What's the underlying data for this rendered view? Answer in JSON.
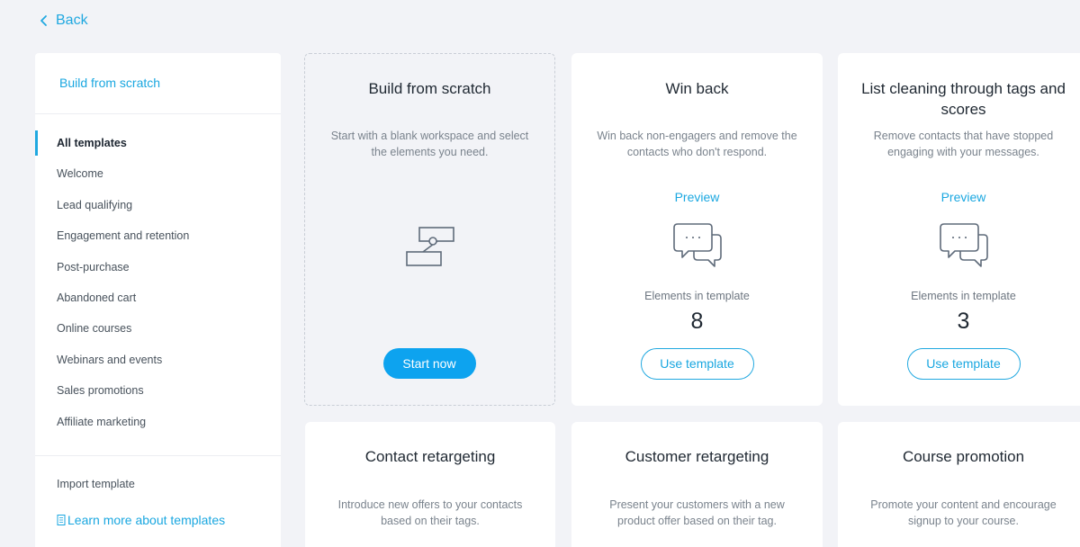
{
  "header": {
    "back_label": "Back"
  },
  "sidebar": {
    "build_from_scratch": "Build from scratch",
    "items": [
      {
        "label": "All templates",
        "active": true
      },
      {
        "label": "Welcome"
      },
      {
        "label": "Lead qualifying"
      },
      {
        "label": "Engagement and retention"
      },
      {
        "label": "Post-purchase"
      },
      {
        "label": "Abandoned cart"
      },
      {
        "label": "Online courses"
      },
      {
        "label": "Webinars and events"
      },
      {
        "label": "Sales promotions"
      },
      {
        "label": "Affiliate marketing"
      }
    ],
    "import_template": "Import template",
    "learn_more": "Learn more about templates"
  },
  "cards": {
    "scratch": {
      "title": "Build from scratch",
      "description": "Start with a blank workspace and select the elements you need.",
      "button": "Start now",
      "icon": "workflow-icon"
    },
    "win_back": {
      "title": "Win back",
      "description": "Win back non-engagers and remove the contacts who don't respond.",
      "preview": "Preview",
      "elements_label": "Elements in template",
      "elements_count": "8",
      "button": "Use template",
      "icon": "chat-bubbles-icon"
    },
    "list_cleaning": {
      "title": "List cleaning through tags and scores",
      "description": "Remove contacts that have stopped engaging with your messages.",
      "preview": "Preview",
      "elements_label": "Elements in template",
      "elements_count": "3",
      "button": "Use template",
      "icon": "chat-bubbles-icon"
    },
    "contact_retargeting": {
      "title": "Contact retargeting",
      "description": "Introduce new offers to your contacts based on their tags."
    },
    "customer_retargeting": {
      "title": "Customer retargeting",
      "description": "Present your customers with a new product offer based on their tag."
    },
    "course_promotion": {
      "title": "Course promotion",
      "description": "Promote your content and encourage signup to your course."
    }
  },
  "colors": {
    "accent": "#1aa7e0",
    "primary_button": "#0da3ef",
    "background": "#f2f3f7"
  }
}
